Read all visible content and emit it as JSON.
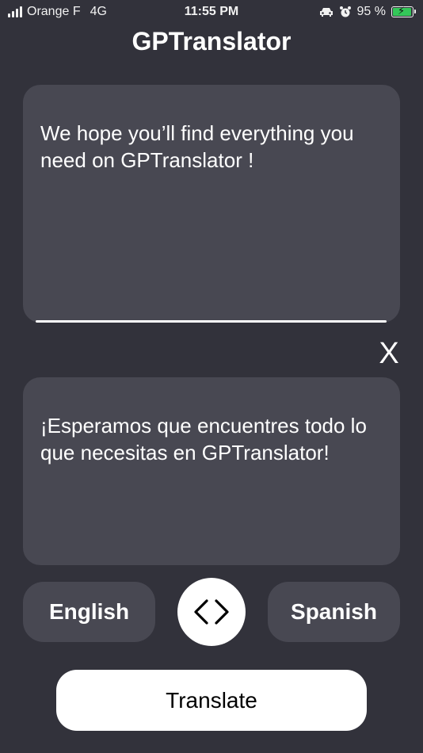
{
  "status_bar": {
    "carrier": "Orange F",
    "network": "4G",
    "time": "11:55 PM",
    "battery_percent": "95 %",
    "battery_level": 0.95,
    "icons": [
      "signal-bars-icon",
      "car-icon",
      "alarm-icon",
      "battery-charging-icon"
    ],
    "battery_color": "#34c759"
  },
  "header": {
    "title": "GPTranslator"
  },
  "source": {
    "text": "We hope you’ll find everything you need on GPTranslator !"
  },
  "clear": {
    "label": "X"
  },
  "target": {
    "text": "¡Esperamos que encuentres todo lo que necesitas en GPTranslator!"
  },
  "languages": {
    "source_label": "English",
    "target_label": "Spanish",
    "swap_icon": "swap-arrows-icon"
  },
  "actions": {
    "translate_label": "Translate"
  },
  "colors": {
    "background": "#32323b",
    "panel": "#484852",
    "text": "#ffffff",
    "button": "#ffffff"
  }
}
